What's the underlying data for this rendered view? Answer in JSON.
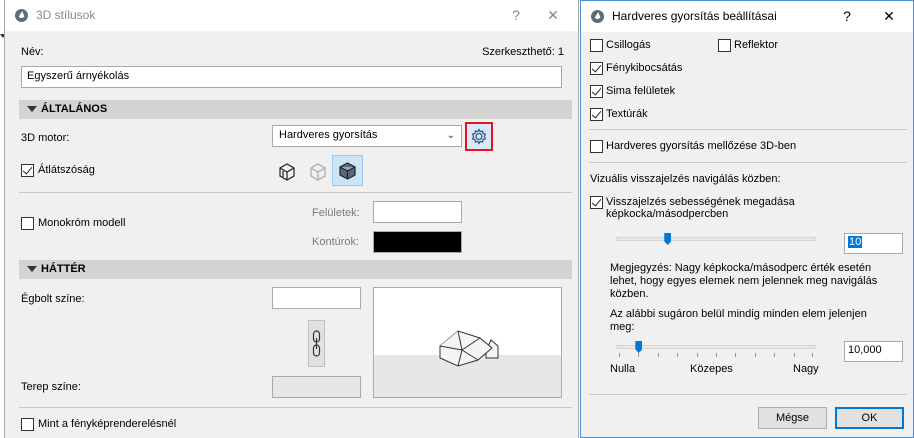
{
  "left_window": {
    "title": "3D stílusok",
    "help_label": "?",
    "close_label": "✕",
    "name_label": "Név:",
    "editable_label": "Szerkeszthető: 1",
    "name_value": "Egyszerű árnyékolás",
    "general_section": "ÁLTALÁNOS",
    "engine_label": "3D motor:",
    "engine_value": "Hardveres gyorsítás",
    "transparency_label": "Átlátszóság",
    "transparency_checked": true,
    "monochrome_label": "Monokróm modell",
    "monochrome_checked": false,
    "surfaces_label": "Felületek:",
    "contours_label": "Kontúrok:",
    "background_section": "HÁTTÉR",
    "sky_color_label": "Égbolt színe:",
    "ground_color_label": "Terep színe:",
    "photorender_label": "Mint a fényképrenderelésnél",
    "photorender_checked": false,
    "colors": {
      "surfaces": "#ffffff",
      "contours": "#000000",
      "sky": "#ffffff",
      "ground": "#e7e7e7",
      "settings_highlight": "#e81123"
    }
  },
  "right_window": {
    "title": "Hardveres gyorsítás beállításai",
    "help_label": "?",
    "close_label": "✕",
    "options": [
      {
        "label": "Csillogás",
        "checked": false
      },
      {
        "label": "Reflektor",
        "checked": false
      },
      {
        "label": "Fénykibocsátás",
        "checked": true
      },
      {
        "label": "Sima felületek",
        "checked": true
      },
      {
        "label": "Textúrák",
        "checked": true
      }
    ],
    "ignore_hw_label": "Hardveres gyorsítás mellőzése 3D-ben",
    "ignore_hw_checked": false,
    "nav_feedback_label": "Vizuális visszajelzés navigálás közben:",
    "fps_checkbox_label_1": "Visszajelzés sebességének megadása",
    "fps_checkbox_label_2": "képkocka/másodpercben",
    "fps_checked": true,
    "fps_value": "10",
    "fps_slider_level": 0.25,
    "note_1": "Megjegyzés: Nagy képkocka/másodperc érték esetén",
    "note_2": "lehet, hogy egyes elemek nem jelennek meg navigálás",
    "note_3": "közben.",
    "radius_label_1": "Az alábbi sugáron belül mindig minden elem jelenjen",
    "radius_label_2": "meg:",
    "radius_value": "10,000",
    "radius_slider_level": 0.1,
    "scale_low": "Nulla",
    "scale_mid": "Közepes",
    "scale_high": "Nagy",
    "cancel_label": "Mégse",
    "ok_label": "OK"
  }
}
